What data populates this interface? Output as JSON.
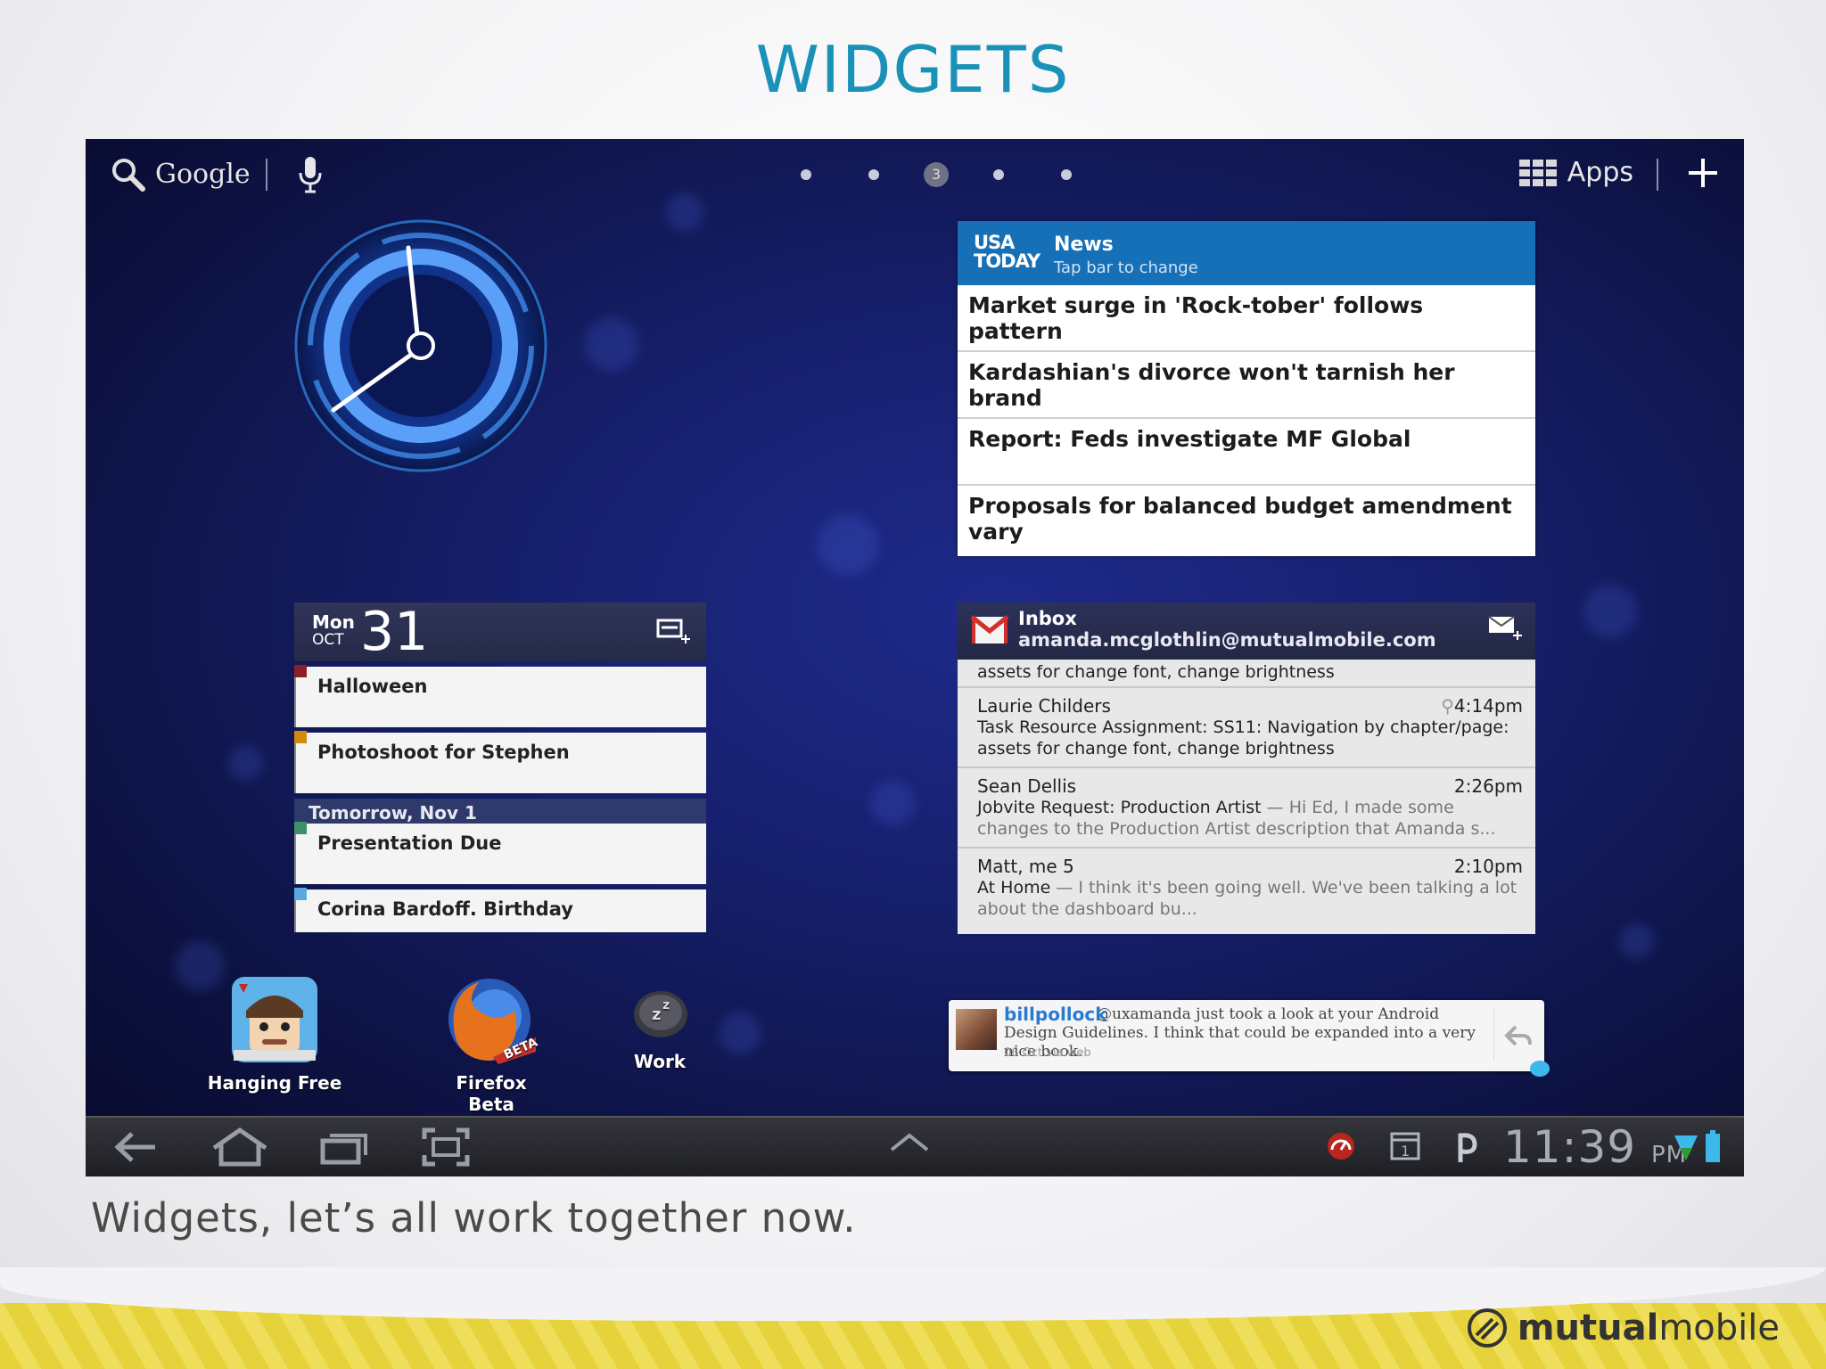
{
  "slide": {
    "title": "WIDGETS",
    "caption": "Widgets, let’s all work together now.",
    "brand_bold": "mutual",
    "brand_light": "mobile"
  },
  "topbar": {
    "search_label": "Google",
    "apps_label": "Apps",
    "current_page": "3"
  },
  "news": {
    "source": "USA TODAY",
    "title": "News",
    "subtitle": "Tap bar to change",
    "headlines": [
      "Market surge in 'Rock-tober' follows pattern",
      "Kardashian's divorce won't tarnish her brand",
      "Report: Feds investigate MF Global",
      "Proposals for balanced budget amendment vary"
    ]
  },
  "calendar": {
    "dow": "Mon",
    "month": "OCT",
    "day": "31",
    "events": [
      {
        "title": "Halloween",
        "color": "#8a1f2a"
      },
      {
        "title": "Photoshoot for Stephen",
        "color": "#d08a10"
      },
      {
        "title": "Presentation Due",
        "color": "#3f8f6a"
      },
      {
        "title": "Corina Bardoff. Birthday",
        "color": "#5aa8e0"
      }
    ],
    "tomorrow": "Tomorrow, Nov 1"
  },
  "gmail": {
    "title": "Inbox",
    "account": "amanda.mcglothlin@mutualmobile.com",
    "partial_top": "assets for change font, change brightness",
    "messages": [
      {
        "from": "Laurie Childers",
        "time": "4:14pm",
        "subject": "Task Resource Assignment: SS11: Navigation by chapter/page: assets for change font, change brightness",
        "snippet": ""
      },
      {
        "from": "Sean Dellis",
        "time": "2:26pm",
        "subject": "Jobvite Request: Production Artist",
        "snippet": " — Hi Ed, I made some changes to the Production Artist description that Amanda s..."
      },
      {
        "from": "Matt, me  5",
        "time": "2:10pm",
        "subject": "At Home",
        "snippet": " — I think it's been going well. We've been talking a lot about the dashboard bu..."
      }
    ]
  },
  "twitter": {
    "user": "billpollock",
    "text": "@uxamanda just took a look at your Android Design Guidelines. I think that could be expanded into a very nice book.",
    "meta": "06 Oct via web"
  },
  "apps": [
    {
      "label": "Hanging Free"
    },
    {
      "label": "Firefox Beta"
    },
    {
      "label": "Work"
    }
  ],
  "statusbar": {
    "time": "11:39",
    "ampm": "PM"
  }
}
